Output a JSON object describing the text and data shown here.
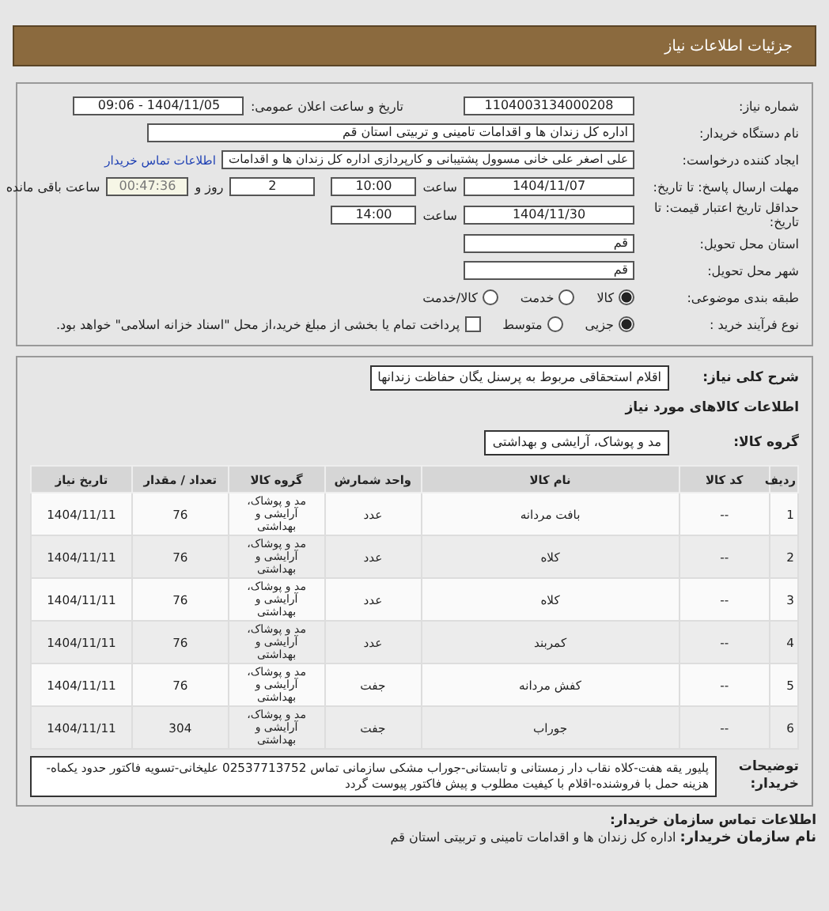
{
  "header": {
    "title": "جزئیات اطلاعات نیاز"
  },
  "need_number": {
    "label": "شماره نیاز:",
    "value": "1104003134000208"
  },
  "announce": {
    "label": "تاریخ و ساعت اعلان عمومی:",
    "value": "1404/11/05 - 09:06"
  },
  "buyer_org": {
    "label": "نام دستگاه خریدار:",
    "value": "اداره کل زندان ها و اقدامات تامینی و تربیتی استان قم"
  },
  "creator": {
    "label": "ایجاد کننده درخواست:",
    "value": "علی اصغر علی خانی مسوول پشتیبانی و کارپردازی اداره کل زندان ها و اقدامات",
    "link": "اطلاعات تماس خریدار"
  },
  "deadline": {
    "label": "مهلت ارسال پاسخ: تا تاریخ:",
    "date": "1404/11/07",
    "time_label": "ساعت",
    "time": "10:00",
    "days": "2",
    "days_label": "روز و",
    "remaining": "00:47:36",
    "remaining_label": "ساعت باقی مانده"
  },
  "validity": {
    "label": "حداقل تاریخ اعتبار قیمت: تا تاریخ:",
    "date": "1404/11/30",
    "time_label": "ساعت",
    "time": "14:00"
  },
  "province": {
    "label": "استان محل تحویل:",
    "value": "قم"
  },
  "city": {
    "label": "شهر محل تحویل:",
    "value": "قم"
  },
  "category": {
    "label": "طبقه بندی موضوعی:",
    "options": [
      {
        "label": "کالا",
        "selected": true
      },
      {
        "label": "خدمت",
        "selected": false
      },
      {
        "label": "کالا/خدمت",
        "selected": false
      }
    ]
  },
  "process": {
    "label": "نوع فرآیند خرید :",
    "options": [
      {
        "label": "جزیی",
        "selected": true
      },
      {
        "label": "متوسط",
        "selected": false
      }
    ],
    "treasury": {
      "label": "پرداخت تمام یا بخشی از مبلغ خرید،از محل \"اسناد خزانه اسلامی\" خواهد بود.",
      "checked": false
    }
  },
  "summary": {
    "label": "شرح کلی نیاز:",
    "value": "اقلام استحقاقی مربوط به پرسنل یگان حفاظت زندانها"
  },
  "goods_title": "اطلاعات کالاهای مورد نیاز",
  "goods_group": {
    "label": "گروه کالا:",
    "value": "مد و پوشاک، آرایشی و بهداشتی"
  },
  "table": {
    "columns": [
      "ردیف",
      "کد کالا",
      "نام کالا",
      "واحد شمارش",
      "گروه کالا",
      "تعداد / مقدار",
      "تاریخ نیاز"
    ],
    "rows": [
      [
        "1",
        "--",
        "بافت مردانه",
        "عدد",
        "مد و پوشاک، آرایشی و بهداشتی",
        "76",
        "1404/11/11"
      ],
      [
        "2",
        "--",
        "کلاه",
        "عدد",
        "مد و پوشاک، آرایشی و بهداشتی",
        "76",
        "1404/11/11"
      ],
      [
        "3",
        "--",
        "کلاه",
        "عدد",
        "مد و پوشاک، آرایشی و بهداشتی",
        "76",
        "1404/11/11"
      ],
      [
        "4",
        "--",
        "کمربند",
        "عدد",
        "مد و پوشاک، آرایشی و بهداشتی",
        "76",
        "1404/11/11"
      ],
      [
        "5",
        "--",
        "کفش مردانه",
        "جفت",
        "مد و پوشاک، آرایشی و بهداشتی",
        "76",
        "1404/11/11"
      ],
      [
        "6",
        "--",
        "جوراب",
        "جفت",
        "مد و پوشاک، آرایشی و بهداشتی",
        "304",
        "1404/11/11"
      ]
    ]
  },
  "buyer_notes": {
    "label": "توضیحات خریدار:",
    "value": "پلیور یقه هفت-کلاه نقاب دار زمستانی و تابستانی-جوراب مشکی سازمانی تماس 02537713752 علیخانی-تسویه فاکتور حدود یکماه-هزینه حمل با فروشنده-اقلام با کیفیت مطلوب و پیش فاکتور پیوست گردد"
  },
  "contact_title": "اطلاعات تماس سازمان خریدار:",
  "contact_org": {
    "label": "نام سازمان خریدار:",
    "value": "اداره کل زندان ها و اقدامات تامینی و تربیتی استان قم"
  }
}
